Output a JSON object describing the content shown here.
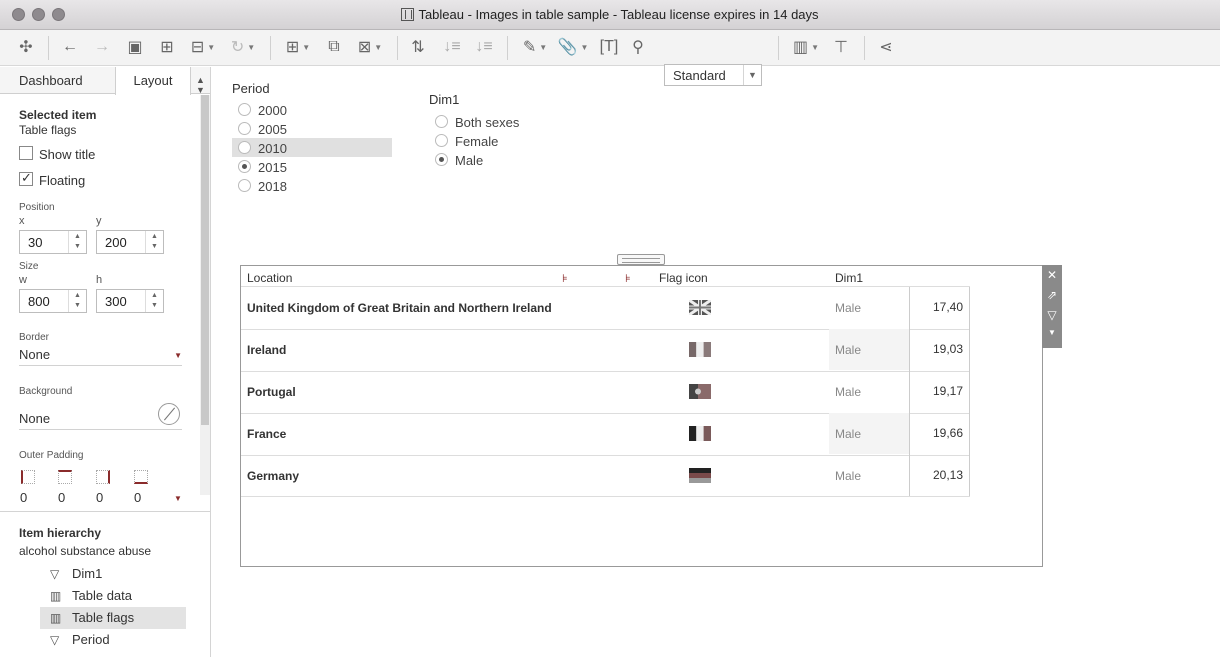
{
  "window": {
    "title": "Tableau - Images in table sample - Tableau license expires in 14 days"
  },
  "toolbar": {
    "view_select": "Standard"
  },
  "left_panel": {
    "tabs": [
      "Dashboard",
      "Layout"
    ],
    "selected_item_heading": "Selected item",
    "selected_item_name": "Table flags",
    "show_title_label": "Show title",
    "show_title_checked": false,
    "floating_label": "Floating",
    "floating_checked": true,
    "position_label": "Position",
    "x_label": "x",
    "x_value": "30",
    "y_label": "y",
    "y_value": "200",
    "size_label": "Size",
    "w_label": "w",
    "w_value": "800",
    "h_label": "h",
    "h_value": "300",
    "border_label": "Border",
    "border_value": "None",
    "background_label": "Background",
    "background_value": "None",
    "outer_padding_label": "Outer Padding",
    "outer_padding_values": [
      "0",
      "0",
      "0",
      "0"
    ],
    "hierarchy_heading": "Item hierarchy",
    "hierarchy_root": "alcohol substance abuse",
    "hierarchy_items": [
      {
        "label": "Dim1",
        "icon": "filter-icon"
      },
      {
        "label": "Table data",
        "icon": "sheet-icon"
      },
      {
        "label": "Table flags",
        "icon": "sheet-icon",
        "selected": true
      },
      {
        "label": "Period",
        "icon": "filter-icon"
      }
    ]
  },
  "period_filter": {
    "title": "Period",
    "options": [
      "2000",
      "2005",
      "2010",
      "2015",
      "2018"
    ],
    "selected": "2015",
    "highlighted": "2010"
  },
  "dim1_filter": {
    "title": "Dim1",
    "options": [
      "Both sexes",
      "Female",
      "Male"
    ],
    "selected": "Male"
  },
  "table": {
    "headers": {
      "location": "Location",
      "flag": "Flag icon",
      "dim1": "Dim1"
    },
    "rows": [
      {
        "location": "United Kingdom of Great Britain and Northern Ireland",
        "flag": "uk-flag-icon",
        "dim1": "Male",
        "value": "17,40"
      },
      {
        "location": "Ireland",
        "flag": "ireland-flag-icon",
        "dim1": "Male",
        "value": "19,03"
      },
      {
        "location": "Portugal",
        "flag": "portugal-flag-icon",
        "dim1": "Male",
        "value": "19,17"
      },
      {
        "location": "France",
        "flag": "france-flag-icon",
        "dim1": "Male",
        "value": "19,66"
      },
      {
        "location": "Germany",
        "flag": "germany-flag-icon",
        "dim1": "Male",
        "value": "20,13"
      }
    ]
  }
}
